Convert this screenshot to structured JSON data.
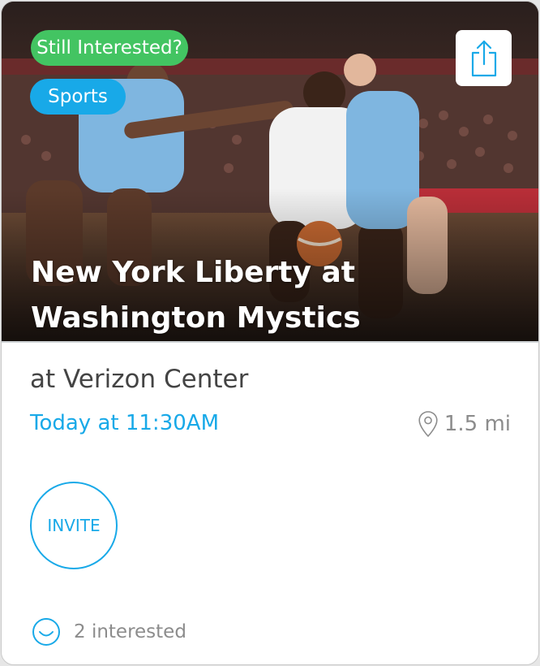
{
  "event": {
    "status_badge": "Still Interested?",
    "category_badge": "Sports",
    "title_line1": "New York Liberty at",
    "title_line2": "Washington Mystics",
    "venue": "at Verizon Center",
    "datetime": "Today at 11:30AM",
    "distance": "1.5 mi",
    "invite_label": "INVITE",
    "interested_count": "2 interested"
  },
  "icons": {
    "share": "share-icon",
    "location": "location-pin-icon",
    "interested": "smiley-icon"
  },
  "colors": {
    "accent": "#18a9e8",
    "interest_badge": "#43c462",
    "category_badge": "#18a9e8",
    "muted_text": "#8c8c8c",
    "body_text": "#444444"
  }
}
